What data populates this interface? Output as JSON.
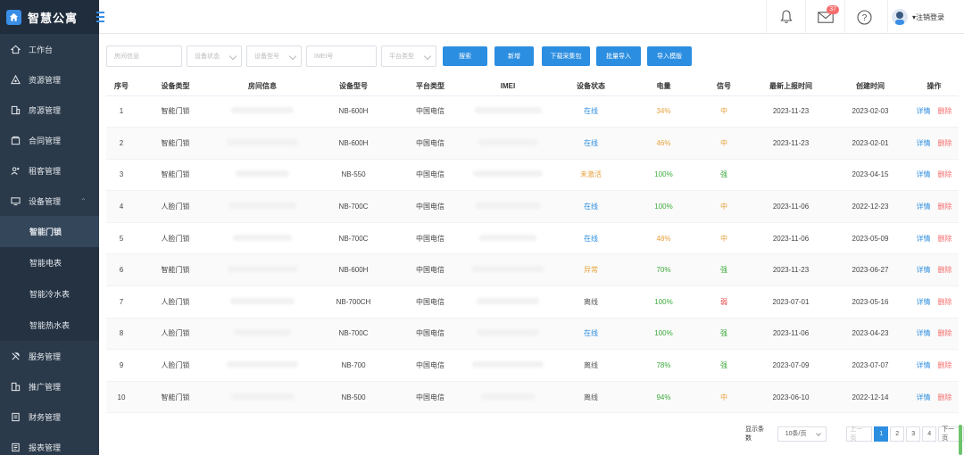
{
  "app": {
    "title": "智慧公寓"
  },
  "sidebar": {
    "items": [
      {
        "label": "工作台",
        "icon": "home-icon"
      },
      {
        "label": "资源管理",
        "icon": "resource-icon"
      },
      {
        "label": "房源管理",
        "icon": "building-icon"
      },
      {
        "label": "合同管理",
        "icon": "contract-icon"
      },
      {
        "label": "租客管理",
        "icon": "tenant-icon"
      },
      {
        "label": "设备管理",
        "icon": "device-icon"
      }
    ],
    "device_sub": [
      {
        "label": "智能门锁"
      },
      {
        "label": "智能电表"
      },
      {
        "label": "智能冷水表"
      },
      {
        "label": "智能热水表"
      }
    ],
    "items_after": [
      {
        "label": "服务管理",
        "icon": "service-icon"
      },
      {
        "label": "推广管理",
        "icon": "promote-icon"
      },
      {
        "label": "财务管理",
        "icon": "finance-icon"
      },
      {
        "label": "报表管理",
        "icon": "report-icon"
      }
    ]
  },
  "header": {
    "mail_badge": "37",
    "user_label": "▾注销登录"
  },
  "filters": {
    "room_placeholder": "房间信息",
    "status_placeholder": "设备状态",
    "model_placeholder": "设备型号",
    "imei_placeholder": "IMEI号",
    "platform_placeholder": "平台类型",
    "buttons": [
      "搜索",
      "新增",
      "下载采集包",
      "批量导入",
      "导入模版"
    ]
  },
  "table": {
    "headers": [
      "序号",
      "设备类型",
      "房间信息",
      "设备型号",
      "平台类型",
      "IMEI",
      "设备状态",
      "电量",
      "信号",
      "最新上报时间",
      "创建时间",
      "操作"
    ],
    "rows": [
      {
        "no": "1",
        "type": "智能门锁",
        "model": "NB-600H",
        "platform": "中国电信",
        "status": "在线",
        "status_class": "st-on",
        "power": "34%",
        "power_class": "pw-orange",
        "signal": "中",
        "signal_class": "sig-mid",
        "last": "2023-11-23",
        "created": "2023-02-03"
      },
      {
        "no": "2",
        "type": "智能门锁",
        "model": "NB-600H",
        "platform": "中国电信",
        "status": "在线",
        "status_class": "st-on",
        "power": "46%",
        "power_class": "pw-orange",
        "signal": "中",
        "signal_class": "sig-mid",
        "last": "2023-11-23",
        "created": "2023-02-01"
      },
      {
        "no": "3",
        "type": "智能门锁",
        "model": "NB-550",
        "platform": "中国电信",
        "status": "未激活",
        "status_class": "st-todo",
        "power": "100%",
        "power_class": "pw-green",
        "signal": "强",
        "signal_class": "sig-strong",
        "last": "",
        "created": "2023-04-15"
      },
      {
        "no": "4",
        "type": "人脸门锁",
        "model": "NB-700C",
        "platform": "中国电信",
        "status": "在线",
        "status_class": "st-on",
        "power": "100%",
        "power_class": "pw-green",
        "signal": "中",
        "signal_class": "sig-mid",
        "last": "2023-11-06",
        "created": "2022-12-23"
      },
      {
        "no": "5",
        "type": "人脸门锁",
        "model": "NB-700C",
        "platform": "中国电信",
        "status": "在线",
        "status_class": "st-on",
        "power": "48%",
        "power_class": "pw-orange",
        "signal": "中",
        "signal_class": "sig-mid",
        "last": "2023-11-06",
        "created": "2023-05-09"
      },
      {
        "no": "6",
        "type": "智能门锁",
        "model": "NB-600H",
        "platform": "中国电信",
        "status": "异常",
        "status_class": "st-err",
        "power": "70%",
        "power_class": "pw-green",
        "signal": "强",
        "signal_class": "sig-strong",
        "last": "2023-11-23",
        "created": "2023-06-27"
      },
      {
        "no": "7",
        "type": "人脸门锁",
        "model": "NB-700CH",
        "platform": "中国电信",
        "status": "离线",
        "status_class": "st-off",
        "power": "100%",
        "power_class": "pw-green",
        "signal": "弱",
        "signal_class": "sig-weak",
        "last": "2023-07-01",
        "created": "2023-05-16"
      },
      {
        "no": "8",
        "type": "人脸门锁",
        "model": "NB-700C",
        "platform": "中国电信",
        "status": "在线",
        "status_class": "st-on",
        "power": "100%",
        "power_class": "pw-green",
        "signal": "强",
        "signal_class": "sig-strong",
        "last": "2023-11-06",
        "created": "2023-04-23"
      },
      {
        "no": "9",
        "type": "人脸门锁",
        "model": "NB-700",
        "platform": "中国电信",
        "status": "离线",
        "status_class": "st-off",
        "power": "78%",
        "power_class": "pw-green",
        "signal": "强",
        "signal_class": "sig-strong",
        "last": "2023-07-09",
        "created": "2023-07-07"
      },
      {
        "no": "10",
        "type": "智能门锁",
        "model": "NB-500",
        "platform": "中国电信",
        "status": "离线",
        "status_class": "st-off",
        "power": "94%",
        "power_class": "pw-green",
        "signal": "中",
        "signal_class": "sig-mid",
        "last": "2023-06-10",
        "created": "2022-12-14"
      }
    ],
    "action_detail": "详情",
    "action_delete": "删除"
  },
  "pager": {
    "label": "显示条数",
    "size": "10条/页",
    "prev": "上一页",
    "pages": [
      "1",
      "2",
      "3",
      "4"
    ],
    "next": "下一页"
  },
  "colors": {
    "accent": "#2c8ee0",
    "sidebar": "#2b3a4a",
    "danger": "#f56c6c"
  }
}
